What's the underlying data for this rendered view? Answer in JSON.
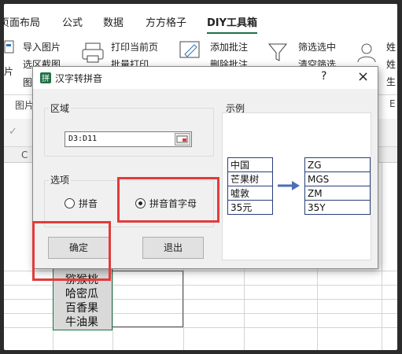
{
  "ribbon": {
    "tabs": [
      "页面布局",
      "公式",
      "数据",
      "方方格子",
      "DIY工具箱"
    ],
    "items": {
      "import_picture": "导入图片",
      "select_area_screenshot": "选区截图",
      "picture_left_1": "片",
      "picture_left_2": "图",
      "print_current_page": "打印当前页",
      "batch_print": "批量打印",
      "add_comment": "添加批注",
      "delete_comment": "删除批注",
      "filter_select": "筛选选中",
      "clear_filter": "清空筛选",
      "right_label_1": "姓",
      "right_label_2": "姓",
      "right_label_3": "生",
      "group_picture": "图片",
      "group_right": "E"
    }
  },
  "sheet": {
    "column_letter_left": "C",
    "rows": [
      "猕猴桃",
      "哈密瓜",
      "百香果",
      "牛油果"
    ]
  },
  "dialog": {
    "title": "汉字转拼音",
    "help": "?",
    "close": "×",
    "range_group_label": "区域",
    "range_value": "D3:D11",
    "options_group_label": "选项",
    "option_pinyin": "拼音",
    "option_initials": "拼音首字母",
    "selected_option": "拼音首字母",
    "ok_label": "确定",
    "cancel_label": "退出",
    "example_label": "示例",
    "example_left": [
      "中国",
      "芒果树",
      "嘘敦",
      "35元"
    ],
    "example_right": [
      "ZG",
      "MGS",
      "ZM",
      "35Y"
    ]
  },
  "colors": {
    "highlight": "#e23b3b",
    "excel_green": "#1e7145",
    "example_arrow": "#4a6fb5"
  }
}
